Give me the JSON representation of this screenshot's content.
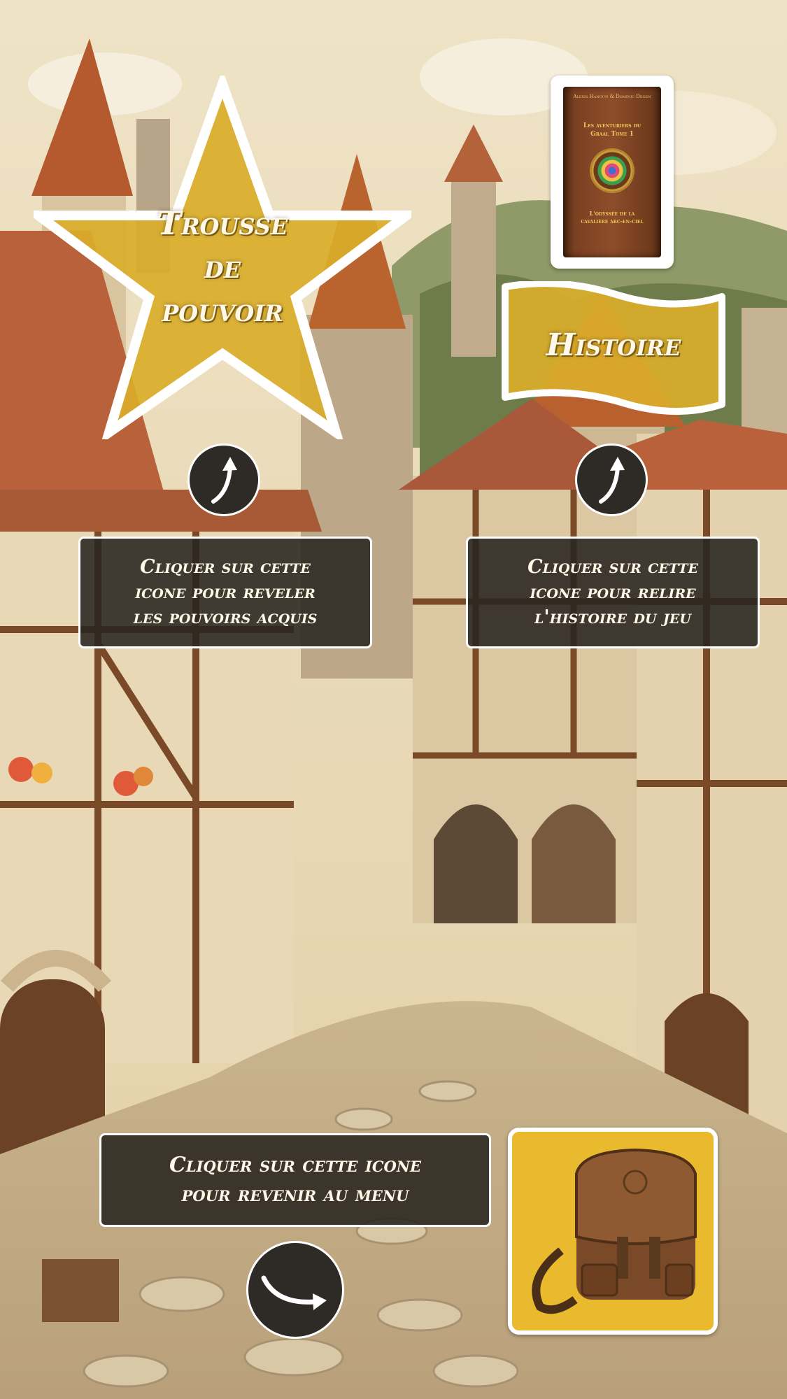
{
  "power_kit": {
    "label_lines": [
      "Trousse",
      "de",
      "pouvoir"
    ],
    "icon": "star-icon",
    "color": "#d9ac2a"
  },
  "story": {
    "label": "Histoire",
    "icon": "banner-icon",
    "color": "#d9ac2a"
  },
  "book": {
    "author": "Alexis Hanoun & Dominic Degen",
    "title_lines": [
      "Les aventuriers du",
      "Graal Tome 1"
    ],
    "subtitle_lines": [
      "L'odyssée de la",
      "cavalière arc-en-ciel"
    ]
  },
  "hints": {
    "powers": [
      "Cliquer sur cette",
      "icone pour reveler",
      "les pouvoirs acquis"
    ],
    "story": [
      "Cliquer sur cette",
      "icone pour relire",
      "l'histoire du jeu"
    ],
    "menu": [
      "Cliquer sur cette icone",
      "pour revenir au menu"
    ]
  },
  "icons": {
    "arrow_up_left": "curved-arrow-up-icon",
    "arrow_up_right": "curved-arrow-up-icon",
    "arrow_menu": "curved-arrow-right-icon",
    "menu_button": "backpack-icon"
  },
  "colors": {
    "gold": "#d9ac2a",
    "panel": "#2e2a26",
    "bag_bg": "#e9b92e"
  }
}
